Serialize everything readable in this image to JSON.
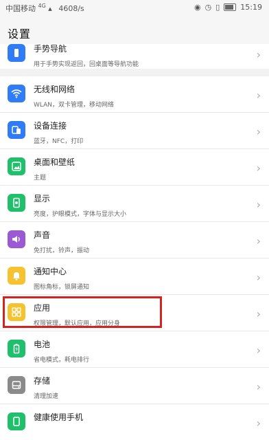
{
  "status_bar": {
    "carrier": "中国移动",
    "network": "4G",
    "speed": "4608/s",
    "time": "15:19"
  },
  "header": {
    "title": "设置"
  },
  "top_item": {
    "title": "手势导航",
    "subtitle": "用于手势实现返回，回桌面等导航功能",
    "icon": "gesture-icon",
    "color": "#2f7cf6"
  },
  "items": [
    {
      "title": "无线和网络",
      "subtitle": "WLAN，双卡管理，移动网络",
      "icon": "wifi-icon",
      "color": "#2f7cf6"
    },
    {
      "title": "设备连接",
      "subtitle": "蓝牙，NFC，打印",
      "icon": "device-connection-icon",
      "color": "#2f7cf6"
    },
    {
      "title": "桌面和壁纸",
      "subtitle": "主题",
      "icon": "wallpaper-icon",
      "color": "#1fbf6b"
    },
    {
      "title": "显示",
      "subtitle": "亮度，护眼模式，字体与显示大小",
      "icon": "display-icon",
      "color": "#1fbf6b"
    },
    {
      "title": "声音",
      "subtitle": "免打扰，铃声，振动",
      "icon": "sound-icon",
      "color": "#9b59d6"
    },
    {
      "title": "通知中心",
      "subtitle": "图标角标，锁屏通知",
      "icon": "notification-icon",
      "color": "#f6c22f"
    },
    {
      "title": "应用",
      "subtitle": "权限管理，默认应用，应用分身",
      "icon": "apps-icon",
      "color": "#f6c22f"
    },
    {
      "title": "电池",
      "subtitle": "省电模式，耗电排行",
      "icon": "battery-icon",
      "color": "#1fbf6b"
    },
    {
      "title": "存储",
      "subtitle": "清理加速",
      "icon": "storage-icon",
      "color": "#8a8a8a"
    },
    {
      "title": "健康使用手机",
      "subtitle": "",
      "icon": "digital-balance-icon",
      "color": "#1fbf6b"
    }
  ]
}
